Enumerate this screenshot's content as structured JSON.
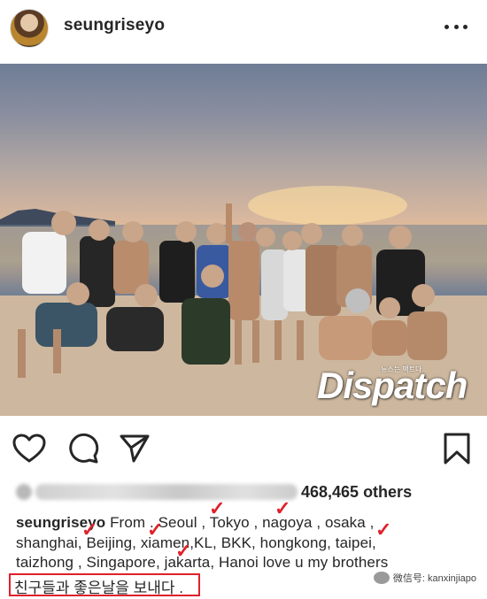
{
  "post": {
    "username": "seungriseyo",
    "likes_text": "468,465 others",
    "caption_user": "seungriseyo",
    "caption_line1": "From . Seoul , Tokyo , nagoya , osaka ,",
    "caption_line2": "shanghai, Beijing, xiamen,KL, BKK, hongkong, taipei,",
    "caption_line3": "taizhong , Singapore, jakarta, Hanoi  love u my brothers",
    "caption_korean": "친구들과 좋은날을 보내다 ."
  },
  "watermark": {
    "brand": "Dispatch",
    "tagline": "뉴스는 팩트다",
    "wechat_text": "微信号: kanxinjiapo"
  },
  "icons": {
    "like": "heart-icon",
    "comment": "comment-icon",
    "share": "send-icon",
    "save": "bookmark-icon",
    "more": "more-dots-icon"
  },
  "colors": {
    "annotation_red": "#e0202a",
    "text": "#262626"
  }
}
